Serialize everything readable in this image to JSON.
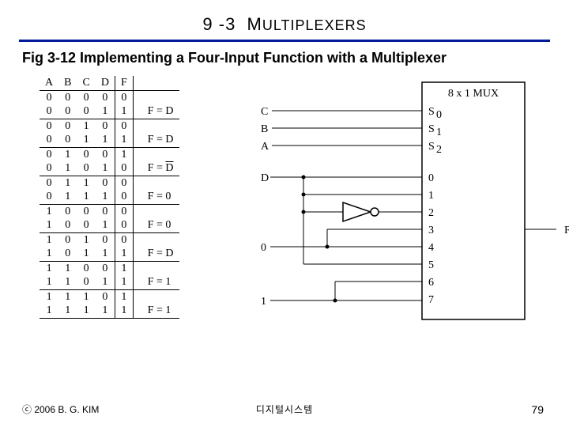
{
  "heading": {
    "num": "9 -3",
    "word": "M",
    "rest": "ULTIPLEXERS"
  },
  "subtitle": "Fig 3-12 Implementing a Four-Input Function with a Multiplexer",
  "table": {
    "headers": [
      "A",
      "B",
      "C",
      "D",
      "F"
    ],
    "rows": [
      {
        "c": [
          "0",
          "0",
          "0",
          "0",
          "0"
        ],
        "sep": 0
      },
      {
        "c": [
          "0",
          "0",
          "0",
          "1",
          "1"
        ],
        "note": "F = D",
        "sep": 1
      },
      {
        "c": [
          "0",
          "0",
          "1",
          "0",
          "0"
        ],
        "sep": 0
      },
      {
        "c": [
          "0",
          "0",
          "1",
          "1",
          "1"
        ],
        "note": "F = D",
        "sep": 1
      },
      {
        "c": [
          "0",
          "1",
          "0",
          "0",
          "1"
        ],
        "sep": 0
      },
      {
        "c": [
          "0",
          "1",
          "0",
          "1",
          "0"
        ],
        "note_over": "F = D̄",
        "sep": 1
      },
      {
        "c": [
          "0",
          "1",
          "1",
          "0",
          "0"
        ],
        "sep": 0
      },
      {
        "c": [
          "0",
          "1",
          "1",
          "1",
          "0"
        ],
        "note": "F = 0",
        "sep": 1
      },
      {
        "c": [
          "1",
          "0",
          "0",
          "0",
          "0"
        ],
        "sep": 0
      },
      {
        "c": [
          "1",
          "0",
          "0",
          "1",
          "0"
        ],
        "note": "F = 0",
        "sep": 1
      },
      {
        "c": [
          "1",
          "0",
          "1",
          "0",
          "0"
        ],
        "sep": 0
      },
      {
        "c": [
          "1",
          "0",
          "1",
          "1",
          "1"
        ],
        "note": "F = D",
        "sep": 1
      },
      {
        "c": [
          "1",
          "1",
          "0",
          "0",
          "1"
        ],
        "sep": 0
      },
      {
        "c": [
          "1",
          "1",
          "0",
          "1",
          "1"
        ],
        "note": "F = 1",
        "sep": 1
      },
      {
        "c": [
          "1",
          "1",
          "1",
          "0",
          "1"
        ],
        "sep": 0
      },
      {
        "c": [
          "1",
          "1",
          "1",
          "1",
          "1"
        ],
        "note": "F = 1",
        "sep": 1
      }
    ]
  },
  "mux": {
    "title": "8 x 1 MUX",
    "selects": [
      "S",
      "S",
      "S"
    ],
    "select_sub": [
      "0",
      "1",
      "2"
    ],
    "select_in": [
      "C",
      "B",
      "A"
    ],
    "data_in_labels": [
      "D",
      "",
      "0",
      "",
      "",
      "",
      "1",
      ""
    ],
    "data_ports": [
      "0",
      "1",
      "2",
      "3",
      "4",
      "5",
      "6",
      "7"
    ],
    "out": "F"
  },
  "footer": {
    "copy": "ⓒ 2006  B. G. KIM",
    "center": "디지털시스템",
    "page": "79"
  }
}
